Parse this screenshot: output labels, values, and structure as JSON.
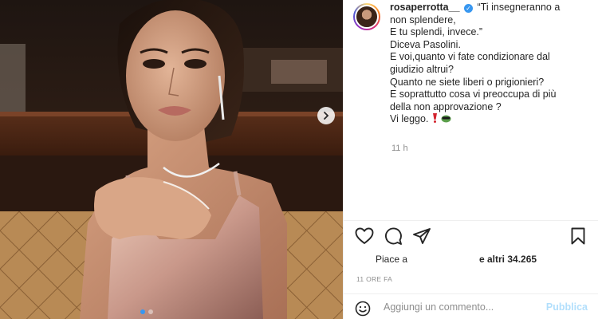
{
  "post": {
    "username": "rosaperrotta__",
    "verified_badge": "verified-badge-icon",
    "caption_lines": [
      "“Ti insegneranno a",
      "non splendere,",
      "E tu splendi, invece.”",
      "Diceva Pasolini.",
      "E voi,quanto vi fate condizionare dal",
      "giudizio altrui?",
      "Quanto ne siete liberi o prigionieri?",
      "E soprattutto cosa vi preoccupa di più",
      "della non approvazione ?",
      "Vi leggo."
    ],
    "caption_emoji": [
      "red-exclamation-icon",
      "mask-face-icon"
    ],
    "caption_time": "11 h"
  },
  "likes": {
    "prefix": "Piace a",
    "suffix": "e altri 34.265"
  },
  "post_time": "11 ORE FA",
  "comment": {
    "placeholder": "Aggiungi un commento...",
    "publish_label": "Pubblica"
  },
  "icons": {
    "like": "heart-icon",
    "comment": "comment-icon",
    "share": "share-icon",
    "save": "bookmark-icon",
    "emoji": "smile-icon",
    "carousel_next": "chevron-right-icon"
  },
  "colors": {
    "accent": "#3897f0",
    "publish_disabled": "#b2dffc",
    "muted_text": "#8e8e8e"
  }
}
